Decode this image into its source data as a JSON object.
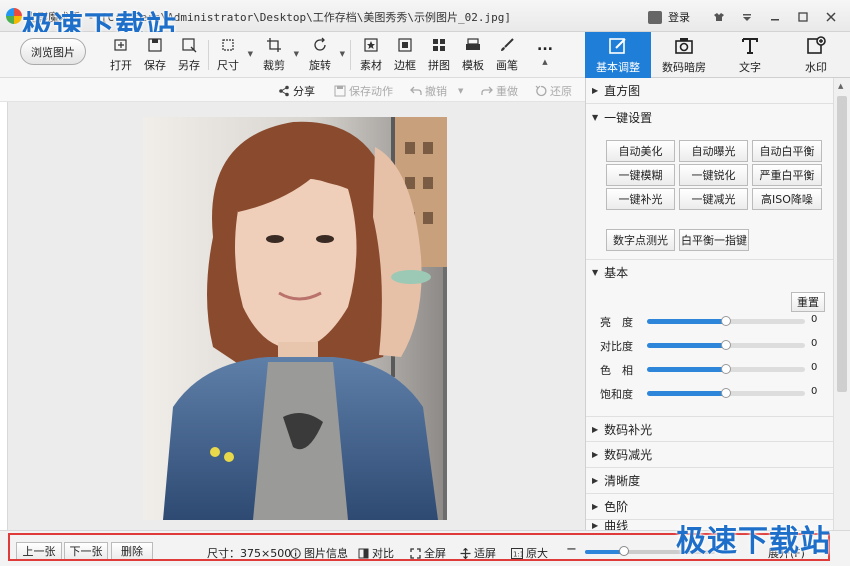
{
  "window": {
    "title": "光影魔术手 - [C:\\Users\\Administrator\\Desktop\\工作存档\\美图秀秀\\示例图片_02.jpg]",
    "login_label": "登录",
    "watermark": "极速下载站"
  },
  "toolbar": {
    "browse_label": "浏览图片",
    "tools": [
      {
        "icon": "open-icon",
        "label": "打开"
      },
      {
        "icon": "save-icon",
        "label": "保存"
      },
      {
        "icon": "save-as-icon",
        "label": "另存"
      },
      {
        "icon": "size-icon",
        "label": "尺寸"
      },
      {
        "icon": "crop-icon",
        "label": "裁剪"
      },
      {
        "icon": "rotate-icon",
        "label": "旋转"
      },
      {
        "icon": "material-icon",
        "label": "素材"
      },
      {
        "icon": "border-icon",
        "label": "边框"
      },
      {
        "icon": "collage-icon",
        "label": "拼图"
      },
      {
        "icon": "template-icon",
        "label": "模板"
      },
      {
        "icon": "brush-icon",
        "label": "画笔"
      },
      {
        "icon": "more-icon",
        "label": "..."
      }
    ]
  },
  "right_tabs": [
    {
      "icon": "basic-adjust-icon",
      "label": "基本调整"
    },
    {
      "icon": "darkroom-icon",
      "label": "数码暗房"
    },
    {
      "icon": "text-icon",
      "label": "文字"
    },
    {
      "icon": "watermark-icon",
      "label": "水印"
    }
  ],
  "actions": {
    "share": "分享",
    "save_action": "保存动作",
    "undo": "撤销",
    "redo": "重做",
    "restore": "还原"
  },
  "panel": {
    "histogram": "直方图",
    "one_click": "一键设置",
    "one_click_buttons": [
      "自动美化",
      "自动曝光",
      "自动白平衡",
      "一键模糊",
      "一键锐化",
      "严重白平衡",
      "一键补光",
      "一键减光",
      "高ISO降噪"
    ],
    "extra_buttons": [
      "数字点测光",
      "白平衡一指键"
    ],
    "basic": "基本",
    "reset": "重置",
    "sliders": [
      {
        "label": "亮　度",
        "value": "0",
        "level": 0.5
      },
      {
        "label": "对比度",
        "value": "0",
        "level": 0.5
      },
      {
        "label": "色　相",
        "value": "0",
        "level": 0.5
      },
      {
        "label": "饱和度",
        "value": "0",
        "level": 0.5
      }
    ],
    "sections": [
      "数码补光",
      "数码减光",
      "清晰度",
      "色阶",
      "曲线"
    ]
  },
  "status": {
    "prev": "上一张",
    "next": "下一张",
    "delete": "删除",
    "size": "尺寸：375×500",
    "info": "图片信息",
    "compare": "对比",
    "fullscreen": "全屏",
    "fit": "适屏",
    "original": "原大",
    "expand": "展开(F)",
    "zoom_level": 0.3
  }
}
